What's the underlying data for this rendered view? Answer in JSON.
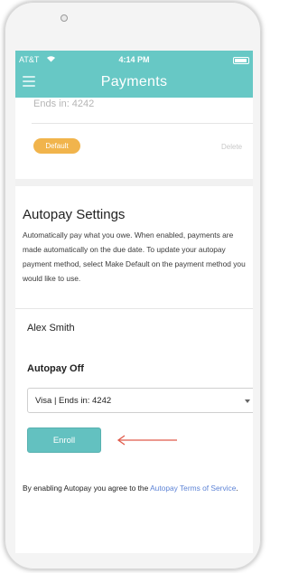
{
  "status_bar": {
    "carrier": "AT&T",
    "time": "4:14 PM"
  },
  "header": {
    "title": "Payments"
  },
  "card": {
    "ends": "Ends in: 4242",
    "default_badge": "Default",
    "delete_label": "Delete"
  },
  "autopay": {
    "title": "Autopay Settings",
    "description": "Automatically pay what you owe. When enabled, payments are made automatically on the due date. To update your autopay payment method, select Make Default on the payment method you would like to use.",
    "customer_name": "Alex Smith",
    "status": "Autopay Off",
    "payment_method": "Visa | Ends in: 4242",
    "enroll_label": "Enroll",
    "terms_prefix": "By enabling Autopay you agree to the ",
    "terms_link": "Autopay Terms of Service",
    "terms_suffix": "."
  },
  "colors": {
    "accent": "#67c8c5",
    "button": "#63c1c0",
    "badge": "#f1b44c",
    "link": "#5e84d6",
    "arrow": "#e05a4a"
  }
}
